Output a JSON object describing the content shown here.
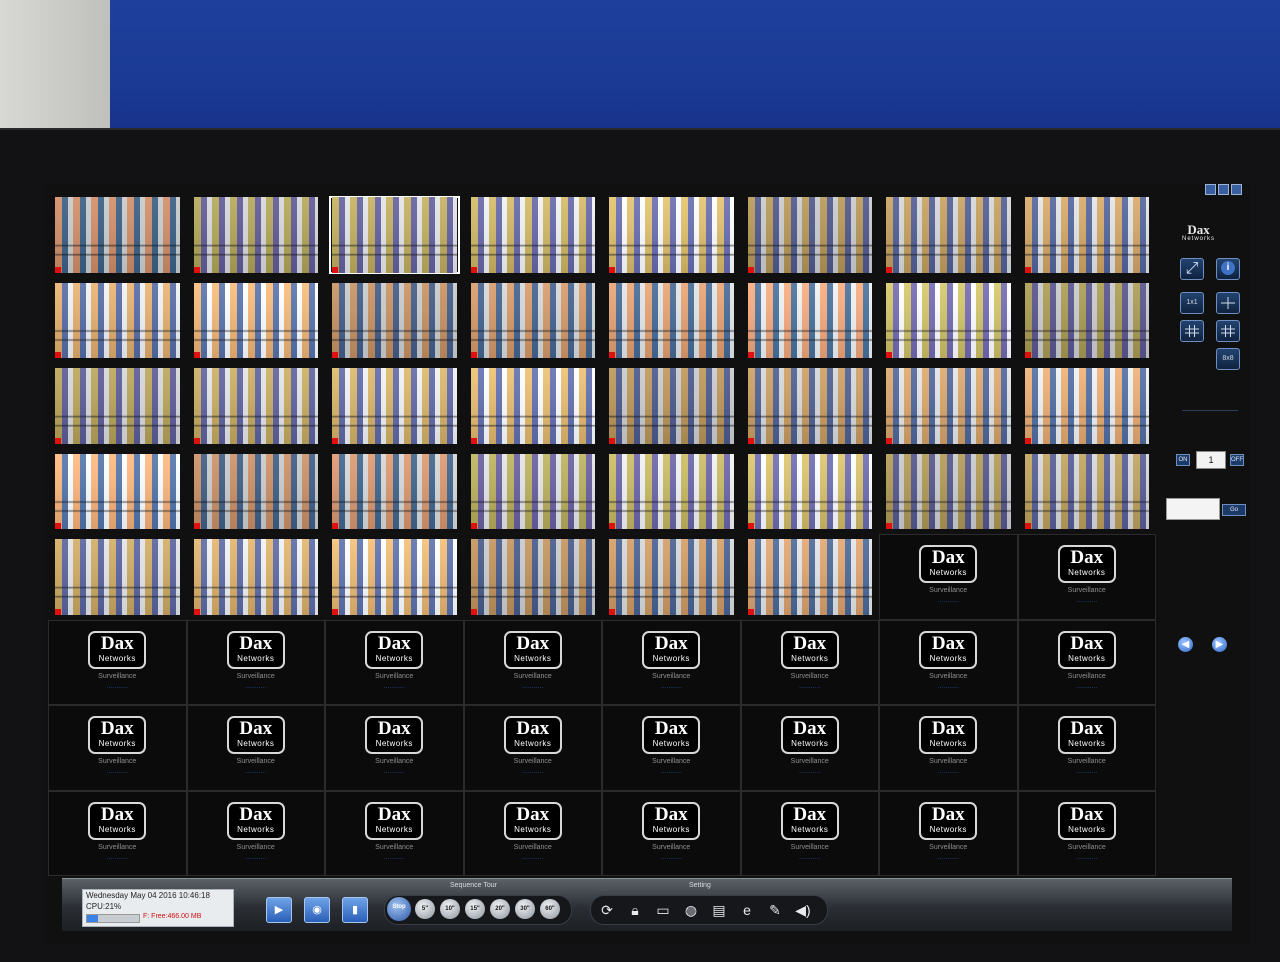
{
  "app": {
    "brand_primary": "Dax",
    "brand_secondary": "Networks",
    "accent_color": "#2f68c9"
  },
  "grid": {
    "cols": 8,
    "rows": 8,
    "selected_camera_index": 2,
    "active_cameras": 38,
    "empty_tile": {
      "logo_big": "Dax",
      "logo_small": "Networks",
      "caption": "Surveillance",
      "caption2": "..........."
    }
  },
  "right_panel": {
    "controls": [
      "help-icon",
      "minimize-icon",
      "close-icon"
    ],
    "full_screen_icon": "fullscreen-icon",
    "info_icon": "info-icon",
    "layout_buttons": [
      "1x1",
      "2x2",
      "3x3",
      "4x4",
      "8x8"
    ],
    "on_label": "ON",
    "off_label": "OFF",
    "spin_value": "1",
    "go_label": "Go",
    "nav": [
      "prev-page-icon",
      "next-page-icon"
    ]
  },
  "status": {
    "datetime": "Wednesday May 04 2016 10:46:18",
    "cpu_label": "CPU:21%",
    "cpu_usage": 0.21,
    "disk": "F: Free:466.00 MB"
  },
  "toolbar": {
    "play_icon": "play-icon",
    "snapshot_icon": "camera-icon",
    "mic_icon": "microphone-icon",
    "sequence_tour_label": "Sequence Tour",
    "tour_buttons": [
      "Stop",
      "5\"",
      "10\"",
      "15\"",
      "20\"",
      "30\"",
      "60\""
    ],
    "setting_label": "Setting",
    "setting_icons": [
      "refresh-icon",
      "lock-icon",
      "folder-icon",
      "globe-icon",
      "document-icon",
      "ie-icon",
      "tools-icon",
      "speaker-icon"
    ]
  }
}
